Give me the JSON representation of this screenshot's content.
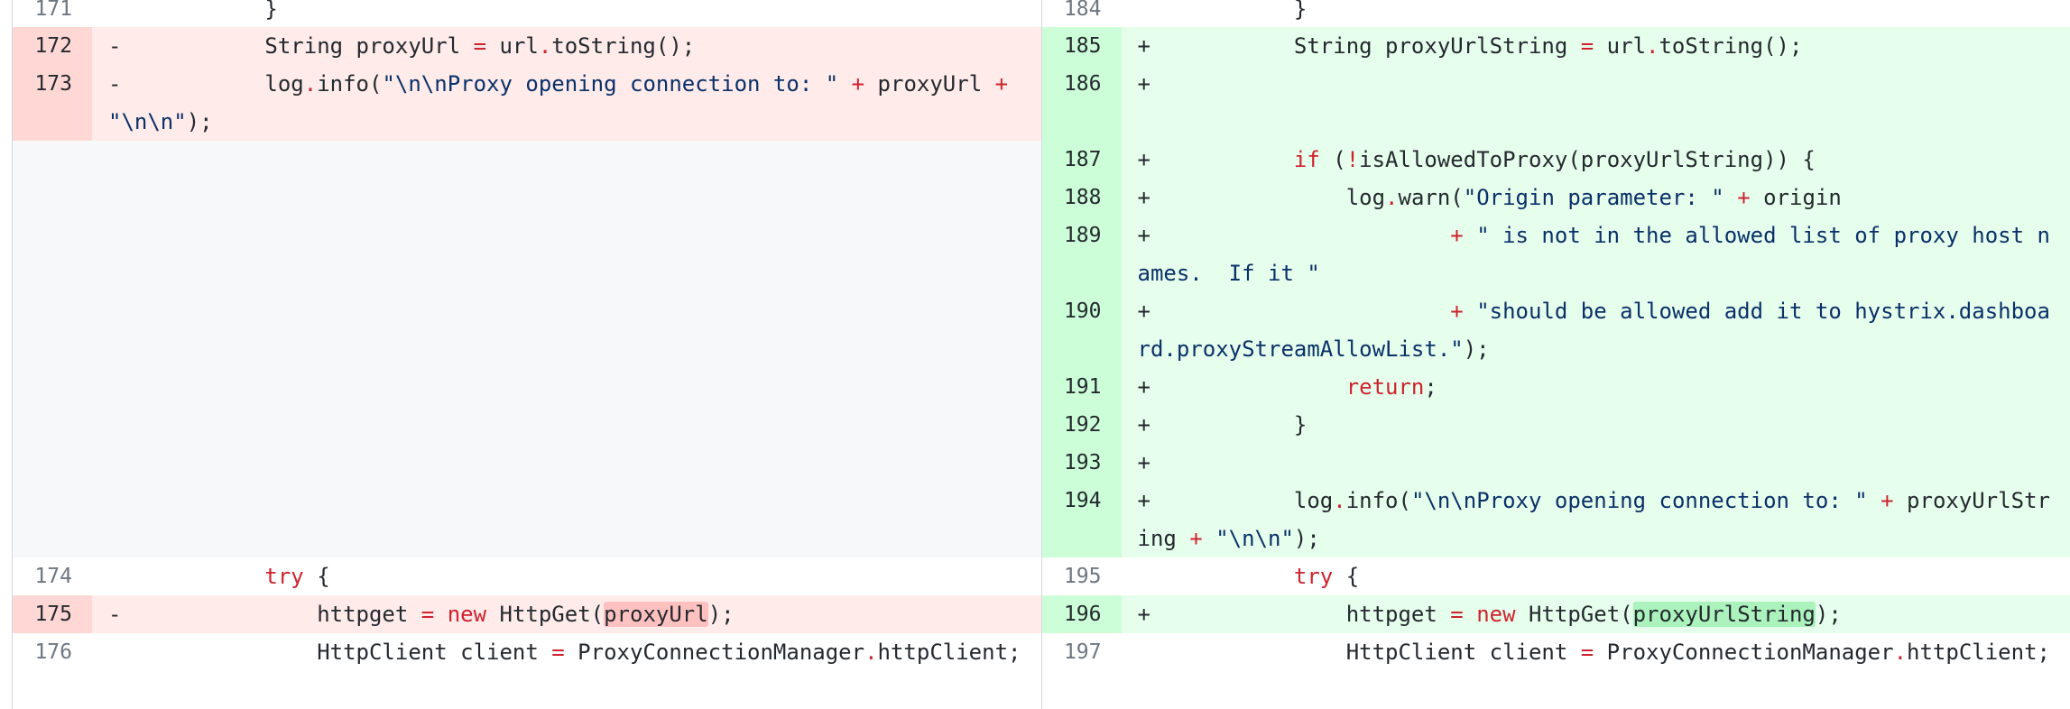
{
  "rows": [
    {
      "left": {
        "type": "ctx",
        "num": "171",
        "code": "            }"
      },
      "right": {
        "type": "ctx",
        "num": "184",
        "code": "            }"
      },
      "h": 30
    },
    {
      "left": {
        "type": "del",
        "num": "172",
        "code": "-           String proxyUrl = url.toString();"
      },
      "right": {
        "type": "add",
        "num": "185",
        "code": "+           String proxyUrlString = url.toString();"
      },
      "h": 42
    },
    {
      "left": {
        "type": "del",
        "num": "173",
        "code": "-           log.info(\"\\n\\nProxy opening connection to: \" + proxyUrl + \"\\n\\n\");"
      },
      "right": {
        "type": "add",
        "num": "186",
        "code": "+"
      },
      "h": 84
    },
    {
      "left": {
        "type": "empty",
        "num": "",
        "code": ""
      },
      "right": {
        "type": "add",
        "num": "187",
        "code": "+           if (!isAllowedToProxy(proxyUrlString)) {"
      },
      "h": 42
    },
    {
      "left": {
        "type": "empty",
        "num": "",
        "code": ""
      },
      "right": {
        "type": "add",
        "num": "188",
        "code": "+               log.warn(\"Origin parameter: \" + origin"
      },
      "h": 42
    },
    {
      "left": {
        "type": "empty",
        "num": "",
        "code": ""
      },
      "right": {
        "type": "add",
        "num": "189",
        "code": "+                       + \" is not in the allowed list of proxy host names.  If it \""
      },
      "h": 84
    },
    {
      "left": {
        "type": "empty",
        "num": "",
        "code": ""
      },
      "right": {
        "type": "add",
        "num": "190",
        "code": "+                       + \"should be allowed add it to hystrix.dashboard.proxyStreamAllowList.\");"
      },
      "h": 84
    },
    {
      "left": {
        "type": "empty",
        "num": "",
        "code": ""
      },
      "right": {
        "type": "add",
        "num": "191",
        "code": "+               return;"
      },
      "h": 42
    },
    {
      "left": {
        "type": "empty",
        "num": "",
        "code": ""
      },
      "right": {
        "type": "add",
        "num": "192",
        "code": "+           }"
      },
      "h": 42
    },
    {
      "left": {
        "type": "empty",
        "num": "",
        "code": ""
      },
      "right": {
        "type": "add",
        "num": "193",
        "code": "+"
      },
      "h": 42
    },
    {
      "left": {
        "type": "empty",
        "num": "",
        "code": ""
      },
      "right": {
        "type": "add",
        "num": "194",
        "code": "+           log.info(\"\\n\\nProxy opening connection to: \" + proxyUrlString + \"\\n\\n\");"
      },
      "h": 84
    },
    {
      "left": {
        "type": "ctx",
        "num": "174",
        "code": "            try {"
      },
      "right": {
        "type": "ctx",
        "num": "195",
        "code": "            try {"
      },
      "h": 42
    },
    {
      "left": {
        "type": "del",
        "num": "175",
        "code": "-               httpget = new HttpGet(proxyUrl);"
      },
      "right": {
        "type": "add",
        "num": "196",
        "code": "+               httpget = new HttpGet(proxyUrlString);"
      },
      "h": 42
    },
    {
      "left": {
        "type": "ctx",
        "num": "176",
        "code": "                HttpClient client = ProxyConnectionManager.httpClient;"
      },
      "right": {
        "type": "ctx",
        "num": "197",
        "code": "                HttpClient client = ProxyConnectionManager.httpClient;"
      },
      "h": 84
    }
  ]
}
